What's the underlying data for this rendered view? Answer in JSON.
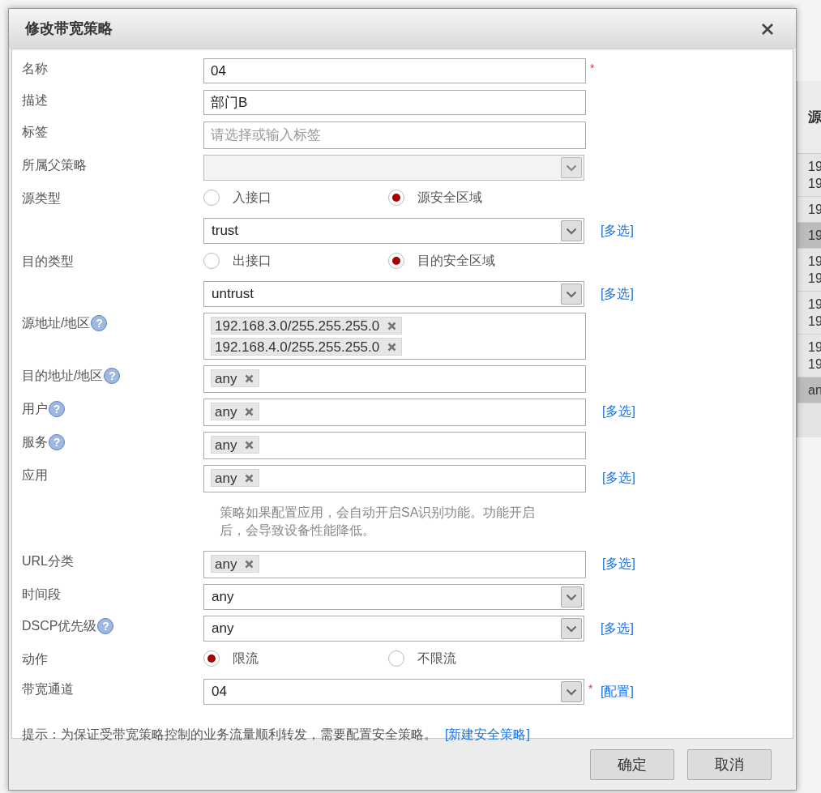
{
  "background_table": {
    "header": "源",
    "rows": [
      {
        "lines": [
          "19",
          "19"
        ],
        "selected": false
      },
      {
        "lines": [
          "19"
        ],
        "selected": false
      },
      {
        "lines": [
          "19"
        ],
        "selected": true
      },
      {
        "lines": [
          "19",
          "19"
        ],
        "selected": false
      },
      {
        "lines": [
          "19",
          "19"
        ],
        "selected": false
      },
      {
        "lines": [
          "19",
          "19"
        ],
        "selected": false
      },
      {
        "lines": [
          "an"
        ],
        "selected": true
      }
    ]
  },
  "dialog": {
    "title": "修改带宽策略",
    "fields": [
      {
        "kind": "text",
        "label": "名称",
        "value": "04",
        "required_mark": "*"
      },
      {
        "kind": "text",
        "label": "描述",
        "value": "部门B"
      },
      {
        "kind": "text",
        "label": "标签",
        "placeholder": "请选择或输入标签"
      },
      {
        "kind": "select",
        "label": "所属父策略",
        "disabled": true
      },
      {
        "kind": "radio",
        "label": "源类型",
        "options": [
          {
            "label": "入接口",
            "selected": false
          },
          {
            "label": "源安全区域",
            "selected": true
          }
        ]
      },
      {
        "kind": "select",
        "value": "trust",
        "link": "[多选]"
      },
      {
        "kind": "radio",
        "label": "目的类型",
        "options": [
          {
            "label": "出接口",
            "selected": false
          },
          {
            "label": "目的安全区域",
            "selected": true
          }
        ]
      },
      {
        "kind": "select",
        "value": "untrust",
        "link": "[多选]"
      },
      {
        "kind": "tags",
        "label": "源地址/地区",
        "help": "?",
        "tags": [
          "192.168.3.0/255.255.255.0",
          "192.168.4.0/255.255.255.0"
        ]
      },
      {
        "kind": "tags",
        "label": "目的地址/地区",
        "help": "?",
        "tags": [
          "any"
        ]
      },
      {
        "kind": "tags",
        "label": "用户",
        "help": "?",
        "tags": [
          "any"
        ],
        "link": "[多选]"
      },
      {
        "kind": "tags",
        "label": "服务",
        "help": "?",
        "tags": [
          "any"
        ]
      },
      {
        "kind": "tags",
        "label": "应用",
        "tags": [
          "any"
        ],
        "link": "[多选]"
      },
      {
        "kind": "note",
        "text": "策略如果配置应用，会自动开启SA识别功能。功能开启后，会导致设备性能降低。"
      },
      {
        "kind": "tags",
        "label": "URL分类",
        "tags": [
          "any"
        ],
        "link": "[多选]"
      },
      {
        "kind": "select",
        "label": "时间段",
        "value": "any"
      },
      {
        "kind": "select",
        "label": "DSCP优先级",
        "help": "?",
        "value": "any",
        "link": "[多选]"
      },
      {
        "kind": "radio",
        "label": "动作",
        "options": [
          {
            "label": "限流",
            "selected": true
          },
          {
            "label": "不限流",
            "selected": false
          }
        ]
      },
      {
        "kind": "select",
        "label": "带宽通道",
        "value": "04",
        "required_mark": "*",
        "link": "[配置]"
      }
    ],
    "tip": {
      "text": "提示：为保证受带宽策略控制的业务流量顺利转发，需要配置安全策略。",
      "link": "[新建安全策略]"
    },
    "buttons": [
      "确定",
      "取消"
    ]
  }
}
